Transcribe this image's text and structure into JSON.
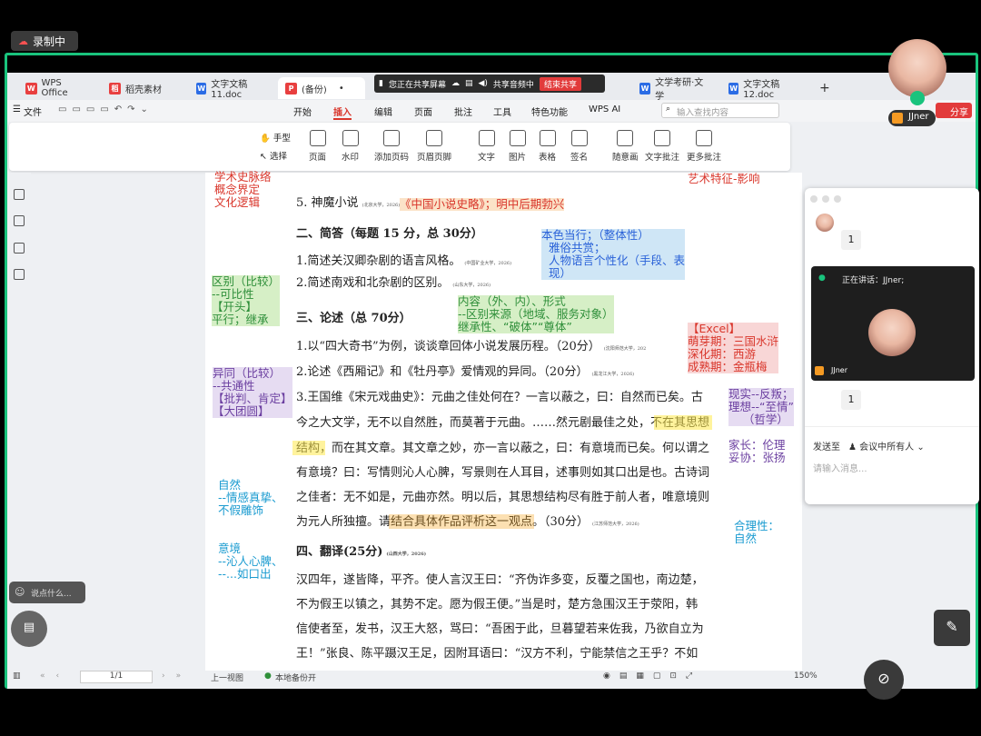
{
  "recording": {
    "label": "录制中"
  },
  "tabs": [
    {
      "label": "WPS Office",
      "color": "#e83f3f"
    },
    {
      "label": "稻壳素材",
      "color": "#e83f3f"
    },
    {
      "label": "文字文稿11.doc",
      "color": "#2b6ce5"
    },
    {
      "label": "(备份)",
      "color": "#e83f3f"
    },
    {
      "label": "文学考研·文学",
      "color": "#2b6ce5"
    },
    {
      "label": "文字文稿12.doc",
      "color": "#2b6ce5"
    }
  ],
  "sharebar": {
    "sharing": "您正在共享屏幕",
    "audio": "共享音频中",
    "end": "结束共享"
  },
  "menu": {
    "file": "文件",
    "items": [
      "开始",
      "插入",
      "编辑",
      "页面",
      "批注",
      "工具",
      "特色功能",
      "WPS AI"
    ],
    "search_placeholder": "输入查找内容",
    "share": "分享"
  },
  "ribbon": {
    "hand": "手型",
    "select": "选择",
    "items": [
      "页面",
      "水印",
      "添加页码",
      "页眉页脚",
      "文字",
      "图片",
      "表格",
      "签名",
      "随意画",
      "文字批注",
      "更多批注"
    ]
  },
  "doc": {
    "l1": "5. 神魔小说",
    "l1src": "(北京大学，2026)",
    "l2": "二、简答（每题 15 分，总 30分）",
    "l3": "1.简述关汉卿杂剧的语言风格。",
    "l3src": "(中国矿业大学，2026)",
    "l4": "2.简述南戏和北杂剧的区别。",
    "l4src": "(山东大学，2026)",
    "l5": "三、论述（总 70分）",
    "l6": "1.以“四大奇书”为例，谈谈章回体小说发展历程。（20分）",
    "l6src": "(沈阳师范大学，202",
    "l7": "2.论述《西厢记》和《牡丹亭》爱情观的异同。（20分）",
    "l7src": "(黑龙江大学，2026)",
    "l8": "3.王国维《宋元戏曲史》：元曲之佳处何在？一言以蔽之，曰：自然而已矣。古",
    "l9": "今之大文学，无不以自然胜，而莫著于元曲。……然元剧最佳之处，不在其思想",
    "l10": "结构，而在其文章。其文章之妙，亦一言以蔽之，曰：有意境而已矣。何以谓之",
    "l11": "有意境？曰：写情则沁人心脾，写景则在人耳目，述事则如其口出是也。古诗词",
    "l12": "之佳者：无不如是，元曲亦然。明以后，其思想结构尽有胜于前人者，唯意境则",
    "l13": "为元人所独擅。请结合具体作品评析这一观点。（30分）",
    "l13src": "(江苏师范大学，2026)",
    "l14": "四、翻译(25分)",
    "l14src": "(山西大学，2026)",
    "l15": "汉四年，遂皆降，平齐。使人言汉王曰：“齐伪诈多变，反覆之国也，南边楚，",
    "l16": "不为假王以镇之，其势不定。愿为假王便。”当是时，楚方急围汉王于荥阳，韩",
    "l17": "信使者至，发书，汉王大怒，骂曰：“吾困于此，旦暮望若来佐我，乃欲自立为",
    "l18": "王！”张良、陈平蹑汉王足，因附耳语曰：“汉方不利，宁能禁信之王乎？不如"
  },
  "notes": {
    "top_left": "学术史脉络\n概念界定\n文化逻辑",
    "top_right": "艺术特征-影响",
    "n1": "《中国小说史略》；明中后期勃兴",
    "n2": "本色当行；（整体性）\n  雅俗共赏；\n  人物语言个性化（手段、表\n  现）",
    "n3": "区别（比较）\n--可比性\n【开头】\n平行；继承",
    "n4": "内容（外、内）、形式\n--区别来源（地域、服务对象）\n继承性、“破体”“尊体”",
    "n5": "【Excel】\n萌芽期：三国水浒\n深化期：西游\n成熟期：金瓶梅",
    "n6": "异同（比较）\n--共通性\n【批判、肯定】\n【大团圆】",
    "n7": "现实--反叛；\n理想--“至情”\n    （哲学）",
    "n8": "家长：伦理\n妥协：张扬",
    "n9": "自然\n--情感真挚、\n不假雕饰",
    "n10": "意境\n--沁人心脾、\n--...如口出",
    "n11": "合理性：\n自然"
  },
  "chat": {
    "speaking": "正在讲话：JJner;",
    "cam_name": "JJner",
    "count1": "1",
    "count2": "1",
    "send_to": "发送至",
    "audience": "会议中所有人",
    "placeholder": "请输入消息..."
  },
  "user": {
    "name": "JJner"
  },
  "comment": {
    "placeholder": "说点什么..."
  },
  "status": {
    "page": "1/1",
    "prev": "上一视图",
    "backup": "本地备份开",
    "zoom": "150%"
  }
}
